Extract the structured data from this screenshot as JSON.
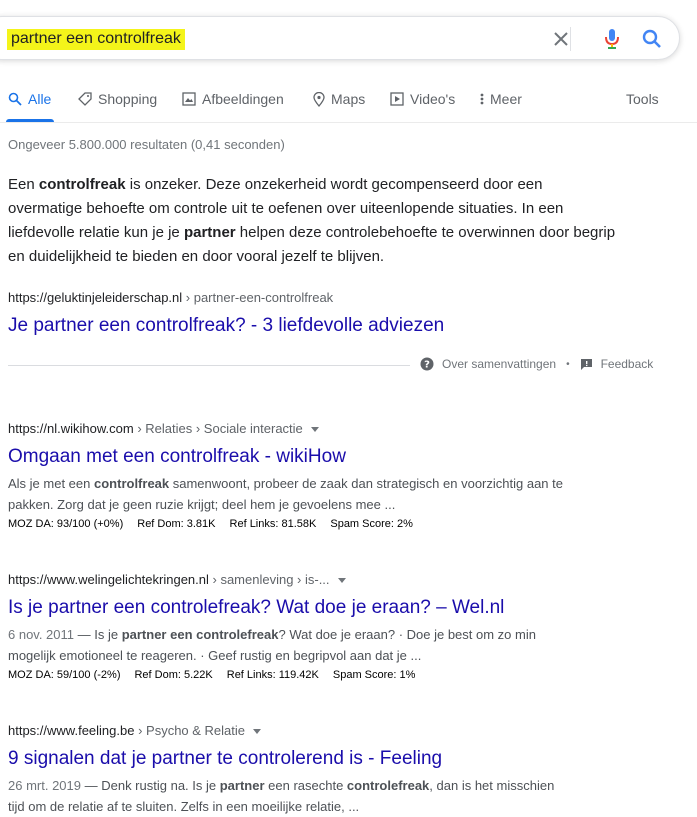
{
  "search": {
    "query": "partner een controlfreak",
    "clear_icon": "close-icon",
    "voice_icon": "microphone-icon",
    "search_icon": "search-icon"
  },
  "tabs": [
    {
      "label": "Alle",
      "icon": "search-icon",
      "active": true
    },
    {
      "label": "Shopping",
      "icon": "tag-icon",
      "active": false
    },
    {
      "label": "Afbeeldingen",
      "icon": "image-icon",
      "active": false
    },
    {
      "label": "Maps",
      "icon": "map-pin-icon",
      "active": false
    },
    {
      "label": "Video's",
      "icon": "play-icon",
      "active": false
    },
    {
      "label": "Meer",
      "icon": "more-vert-icon",
      "active": false
    }
  ],
  "tools_label": "Tools",
  "stats": "Ongeveer 5.800.000 resultaten (0,41 seconden)",
  "featured": {
    "snippet": {
      "l1a": "Een ",
      "l1b": "controlfreak",
      "l1c": " is onzeker. Deze onzekerheid wordt gecompenseerd door een",
      "l2": "overmatige behoefte om controle uit te oefenen over uiteenlopende situaties. In een",
      "l3a": "liefdevolle relatie kun je je ",
      "l3b": "partner",
      "l3c": " helpen deze controlebehoefte te overwinnen door begrip",
      "l4": "en duidelijkheid te bieden en door vooral jezelf te blijven."
    },
    "url": "https://geluktinjeleiderschap.nl",
    "breadcrumb": " › partner-een-controlfreak",
    "title": "Je partner een controlfreak? - 3 liefdevolle adviezen",
    "about_label": "Over samenvattingen",
    "feedback_label": "Feedback"
  },
  "results": [
    {
      "url": "https://nl.wikihow.com",
      "breadcrumb": " › Relaties › Sociale interactie",
      "title": "Omgaan met een controlfreak - wikiHow",
      "desc": {
        "l1a": "Als je met een ",
        "l1b": "controlfreak",
        "l1c": " samenwoont, probeer de zaak dan strategisch en voorzichtig aan te",
        "l2": "pakken. Zorg dat je geen ruzie krijgt; deel hem je gevoelens mee ..."
      },
      "moz": {
        "da": "MOZ DA: 93/100 (+0%)",
        "dom": "Ref Dom: 3.81K",
        "links": "Ref Links: 81.58K",
        "spam": "Spam Score: 2%"
      }
    },
    {
      "url": "https://www.welingelichtekringen.nl",
      "breadcrumb": " › samenleving › is-...",
      "title": "Is je partner een controlefreak? Wat doe je eraan? – Wel.nl",
      "desc": {
        "date": "6 nov. 2011",
        "l1a": " — Is je ",
        "l1b": "partner een controlefreak",
        "l1c": "? Wat doe je eraan? · Doe je best om zo min",
        "l2": "mogelijk emotioneel te reageren. · Geef rustig en begripvol aan dat je ..."
      },
      "moz": {
        "da": "MOZ DA: 59/100 (-2%)",
        "dom": "Ref Dom: 5.22K",
        "links": "Ref Links: 119.42K",
        "spam": "Spam Score: 1%"
      }
    },
    {
      "url": "https://www.feeling.be",
      "breadcrumb": " › Psycho & Relatie",
      "title": "9 signalen dat je partner te controlerend is - Feeling",
      "desc": {
        "date": "26 mrt. 2019",
        "l1a": " — Denk rustig na. Is je ",
        "l1b": "partner",
        "l1c": " een rasechte ",
        "l1d": "controlefreak",
        "l1e": ", dan is het misschien",
        "l2": "tijd om de relatie af te sluiten. Zelfs in een moeilijke relatie, ..."
      }
    }
  ]
}
